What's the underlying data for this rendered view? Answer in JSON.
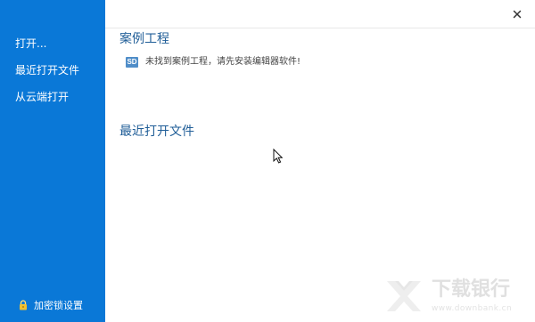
{
  "sidebar": {
    "items": [
      {
        "label": "打开..."
      },
      {
        "label": "最近打开文件"
      },
      {
        "label": "从云端打开"
      }
    ],
    "lock_setting_label": "加密锁设置"
  },
  "sample": {
    "title": "案例工程",
    "badge": "SD",
    "notice": "未找到案例工程，请先安装编辑器软件!"
  },
  "recent": {
    "title": "最近打开文件"
  },
  "watermark": {
    "brand": "下载银行",
    "url": "www.downbank.cn"
  },
  "colors": {
    "sidebar": "#0a78d7",
    "title": "#1f5d97",
    "badge": "#4f8dc8"
  }
}
